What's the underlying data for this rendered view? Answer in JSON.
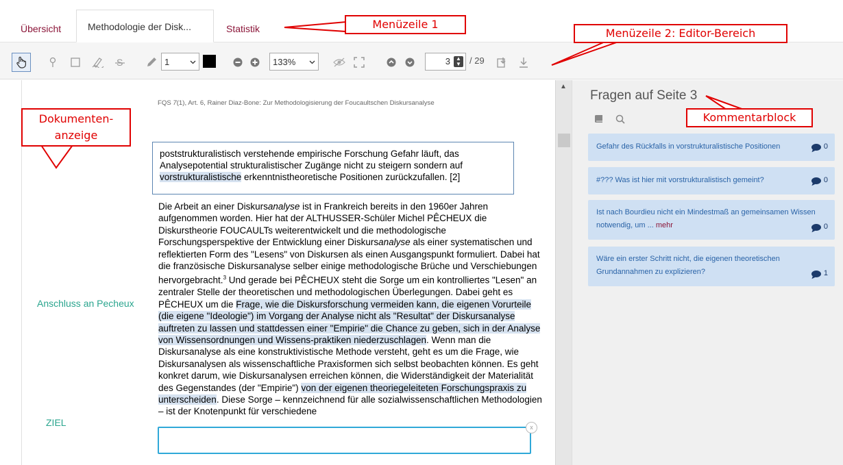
{
  "tabs": [
    {
      "label": "Übersicht"
    },
    {
      "label": "Methodologie der Disk..."
    },
    {
      "label": "Statistik"
    }
  ],
  "toolbar": {
    "icons": [
      "hand-pointer-icon",
      "pin-icon",
      "rectangle-icon",
      "pen-icon",
      "strikethrough-icon",
      "pencil-icon",
      "minus-circle-icon",
      "plus-circle-icon",
      "eye-slash-icon",
      "fullscreen-icon",
      "arrow-up-circle-icon",
      "arrow-down-circle-icon",
      "import-icon",
      "download-icon"
    ],
    "line_width": "1",
    "color": "#000000",
    "zoom": "133%",
    "page": "3",
    "page_total": "/ 29"
  },
  "document": {
    "header_pre": "FQS ",
    "header_issue": "7",
    "header_post": "(1), Art. 6, Rainer Diaz-Bone: Zur Methodologisierung der Foucaultschen Diskursanalyse",
    "quote_part1": "poststrukturalistisch verstehende empirische Forschung Gefahr läuft, das Analysepotential strukturalistischer Zugänge nicht zu steigern sondern auf ",
    "quote_highlight": "vorstrukturalistische",
    "quote_part2": " erkenntnistheoretische Positionen zurückzufallen. [2]",
    "body_p1": "Die Arbeit an einer Diskurs",
    "body_p1_italic": "analyse",
    "body_p2": " ist in Frankreich bereits in den 1960er Jahren aufgenommen worden. Hier hat der ALTHUSSER-Schüler Michel PÊCHEUX die Diskurstheorie FOUCAULTs weiterentwickelt und die methodologische Forschungsperspektive der Entwicklung einer Diskurs",
    "body_p2_italic": "analyse",
    "body_p3": " als einer systematischen und reflektierten Form des \"Lesens\" von Diskursen als einen Ausgangspunkt formuliert. Dabei hat die französische Diskursanalyse selber einige methodologische Brüche und Verschiebungen hervorgebracht.",
    "body_footnote": "3",
    "body_p4": " Und gerade bei PÊCHEUX steht die Sorge um ein kontrolliertes \"Lesen\" an zentraler Stelle der theoretischen und methodologischen Überlegungen. Dabei geht es PÊCHEUX um die ",
    "body_hl1": "Frage, wie die Diskursforschung vermeiden kann, die eigenen Vorurteile (die eigene \"Ideologie\") im Vorgang der Analyse nicht als \"Resultat\" der Diskursanalyse auftreten zu lassen und stattdessen einer \"Empirie\" die Chance zu geben, sich in der Analyse von Wissensordnungen und Wissens-praktiken niederzuschlagen",
    "body_p5": ". Wenn man die Diskursanalyse als eine konstruktivistische Methode versteht, geht es um die Frage, wie Diskursanalysen als wissenschaftliche Praxisformen sich selbst beobachten können. Es geht konkret darum, wie Diskursanalysen erreichen können, die Widerständigkeit der Materialität des Gegenstandes (der \"Empirie\") ",
    "body_hl2": "von der eigenen theoriegeleiteten Forschungspraxis zu unterscheiden",
    "body_p6": ". Diese Sorge – kennzeichnend für alle sozialwissenschaftlichen Methodologien – ist der Knotenpunkt für verschiedene",
    "label_pecheux": "Anschluss an Pecheux",
    "label_ziel": "ZIEL",
    "close_glyph": "x"
  },
  "panel": {
    "title": "Fragen auf Seite 3",
    "comments": [
      {
        "text": "Gefahr des Rückfalls in vorstrukturalistische Positionen",
        "more": "",
        "count": "0"
      },
      {
        "text": "#??? Was ist hier mit vorstrukturalistisch gemeint?",
        "more": "",
        "count": "0"
      },
      {
        "text": "Ist nach Bourdieu nicht ein Mindestmaß an gemeinsamen Wissen notwendig, um ... ",
        "more": "mehr",
        "count": "0"
      },
      {
        "text": "Wäre ein erster Schritt nicht, die eigenen theoretischen Grundannahmen zu explizieren?",
        "more": "",
        "count": "1"
      }
    ]
  },
  "callouts": {
    "menu1": "Menüzeile 1",
    "menu2": "Menüzeile 2: Editor-Bereich",
    "doc_line1": "Dokumenten-",
    "doc_line2": "anzeige",
    "comment_block": "Kommentarblock"
  },
  "colors": {
    "accent": "#8b1538",
    "callout_red": "#e00000",
    "label_green": "#2aa58e",
    "comment_bg": "#cfe0f3"
  }
}
